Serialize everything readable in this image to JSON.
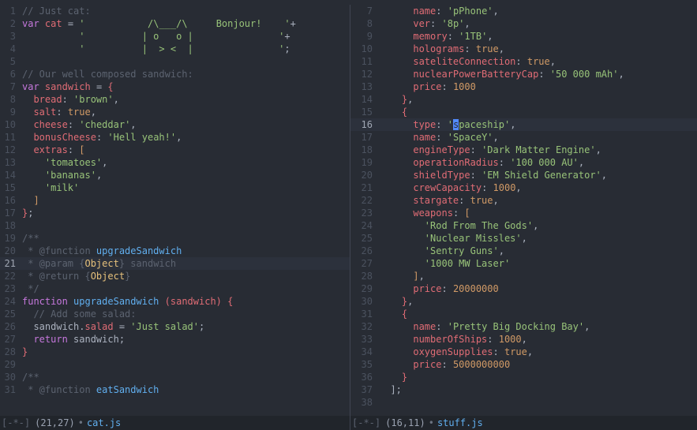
{
  "left": {
    "filename": "cat.js",
    "cursor": "(21,27)",
    "status_prefix": "[-*-]",
    "current_line": 21,
    "first_lineno": 1,
    "lines": [
      {
        "t": [
          [
            "cmt",
            "// Just cat:"
          ]
        ]
      },
      {
        "t": [
          [
            "kw",
            "var"
          ],
          [
            "p",
            " "
          ],
          [
            "prop",
            "cat"
          ],
          [
            "p",
            " = "
          ],
          [
            "str",
            "'           /\\___/\\     Bonjour!    '"
          ],
          [
            "p",
            "+"
          ]
        ]
      },
      {
        "t": [
          [
            "p",
            "          "
          ],
          [
            "str",
            "'          | o   o |               '"
          ],
          [
            "p",
            "+"
          ]
        ]
      },
      {
        "t": [
          [
            "p",
            "          "
          ],
          [
            "str",
            "'          |  > <  |               '"
          ],
          [
            "p",
            ";"
          ]
        ]
      },
      {
        "t": []
      },
      {
        "t": [
          [
            "cmt",
            "// Our well composed sandwich:"
          ]
        ]
      },
      {
        "t": [
          [
            "kw",
            "var"
          ],
          [
            "p",
            " "
          ],
          [
            "prop",
            "sandwich"
          ],
          [
            "p",
            " = "
          ],
          [
            "wrap1",
            "{"
          ]
        ]
      },
      {
        "t": [
          [
            "p",
            "  "
          ],
          [
            "prop",
            "bread"
          ],
          [
            "p",
            ": "
          ],
          [
            "str",
            "'brown'"
          ],
          [
            "p",
            ","
          ]
        ]
      },
      {
        "t": [
          [
            "p",
            "  "
          ],
          [
            "prop",
            "salt"
          ],
          [
            "p",
            ": "
          ],
          [
            "bool",
            "true"
          ],
          [
            "p",
            ","
          ]
        ]
      },
      {
        "t": [
          [
            "p",
            "  "
          ],
          [
            "prop",
            "cheese"
          ],
          [
            "p",
            ": "
          ],
          [
            "str",
            "'cheddar'"
          ],
          [
            "p",
            ","
          ]
        ]
      },
      {
        "t": [
          [
            "p",
            "  "
          ],
          [
            "prop",
            "bonusCheese"
          ],
          [
            "p",
            ": "
          ],
          [
            "str",
            "'Hell yeah!'"
          ],
          [
            "p",
            ","
          ]
        ]
      },
      {
        "t": [
          [
            "p",
            "  "
          ],
          [
            "prop",
            "extras"
          ],
          [
            "p",
            ": "
          ],
          [
            "wrap2",
            "["
          ]
        ]
      },
      {
        "t": [
          [
            "p",
            "    "
          ],
          [
            "str",
            "'tomatoes'"
          ],
          [
            "p",
            ","
          ]
        ]
      },
      {
        "t": [
          [
            "p",
            "    "
          ],
          [
            "str",
            "'bananas'"
          ],
          [
            "p",
            ","
          ]
        ]
      },
      {
        "t": [
          [
            "p",
            "    "
          ],
          [
            "str",
            "'milk'"
          ]
        ]
      },
      {
        "t": [
          [
            "p",
            "  "
          ],
          [
            "wrap2",
            "]"
          ]
        ]
      },
      {
        "t": [
          [
            "wrap1",
            "}"
          ],
          [
            "p",
            ";"
          ]
        ]
      },
      {
        "t": []
      },
      {
        "t": [
          [
            "cmt",
            "/**"
          ]
        ]
      },
      {
        "t": [
          [
            "cmt",
            " * @function "
          ],
          [
            "fn",
            "upgradeSandwich"
          ]
        ]
      },
      {
        "t": [
          [
            "cmt",
            " * @param {"
          ],
          [
            "type",
            "Object"
          ],
          [
            "cmt",
            "} sandwich"
          ]
        ]
      },
      {
        "t": [
          [
            "cmt",
            " * @return {"
          ],
          [
            "type",
            "Object"
          ],
          [
            "cmt",
            "}"
          ]
        ]
      },
      {
        "t": [
          [
            "cmt",
            " */"
          ]
        ]
      },
      {
        "t": [
          [
            "kw",
            "function"
          ],
          [
            "p",
            " "
          ],
          [
            "fn",
            "upgradeSandwich"
          ],
          [
            "p",
            " "
          ],
          [
            "wrap1",
            "("
          ],
          [
            "prm",
            "sandwich"
          ],
          [
            "wrap1",
            ")"
          ],
          [
            "p",
            " "
          ],
          [
            "wrap1",
            "{"
          ]
        ]
      },
      {
        "t": [
          [
            "p",
            "  "
          ],
          [
            "cmt",
            "// Add some salad:"
          ]
        ]
      },
      {
        "t": [
          [
            "p",
            "  sandwich."
          ],
          [
            "prop",
            "salad"
          ],
          [
            "p",
            " = "
          ],
          [
            "str",
            "'Just salad'"
          ],
          [
            "p",
            ";"
          ]
        ]
      },
      {
        "t": [
          [
            "p",
            "  "
          ],
          [
            "kw",
            "return"
          ],
          [
            "p",
            " sandwich;"
          ]
        ]
      },
      {
        "t": [
          [
            "wrap1",
            "}"
          ]
        ]
      },
      {
        "t": []
      },
      {
        "t": [
          [
            "cmt",
            "/**"
          ]
        ]
      },
      {
        "t": [
          [
            "cmt",
            " * @function "
          ],
          [
            "fn",
            "eatSandwich"
          ]
        ]
      }
    ]
  },
  "right": {
    "filename": "stuff.js",
    "cursor": "(16,11)",
    "status_prefix": "[-*-]",
    "current_line": 16,
    "first_lineno": 7,
    "lines": [
      {
        "t": [
          [
            "p",
            "      "
          ],
          [
            "prop",
            "name"
          ],
          [
            "p",
            ": "
          ],
          [
            "str",
            "'pPhone'"
          ],
          [
            "p",
            ","
          ]
        ]
      },
      {
        "t": [
          [
            "p",
            "      "
          ],
          [
            "prop",
            "ver"
          ],
          [
            "p",
            ": "
          ],
          [
            "str",
            "'8p'"
          ],
          [
            "p",
            ","
          ]
        ]
      },
      {
        "t": [
          [
            "p",
            "      "
          ],
          [
            "prop",
            "memory"
          ],
          [
            "p",
            ": "
          ],
          [
            "str",
            "'1TB'"
          ],
          [
            "p",
            ","
          ]
        ]
      },
      {
        "t": [
          [
            "p",
            "      "
          ],
          [
            "prop",
            "holograms"
          ],
          [
            "p",
            ": "
          ],
          [
            "bool",
            "true"
          ],
          [
            "p",
            ","
          ]
        ]
      },
      {
        "t": [
          [
            "p",
            "      "
          ],
          [
            "prop",
            "sateliteConnection"
          ],
          [
            "p",
            ": "
          ],
          [
            "bool",
            "true"
          ],
          [
            "p",
            ","
          ]
        ]
      },
      {
        "t": [
          [
            "p",
            "      "
          ],
          [
            "prop",
            "nuclearPowerBatteryCap"
          ],
          [
            "p",
            ": "
          ],
          [
            "str",
            "'50 000 mAh'"
          ],
          [
            "p",
            ","
          ]
        ]
      },
      {
        "t": [
          [
            "p",
            "      "
          ],
          [
            "prop",
            "price"
          ],
          [
            "p",
            ": "
          ],
          [
            "num",
            "1000"
          ]
        ]
      },
      {
        "t": [
          [
            "p",
            "    "
          ],
          [
            "wrap1",
            "}"
          ],
          [
            "p",
            ","
          ]
        ]
      },
      {
        "t": [
          [
            "p",
            "    "
          ],
          [
            "wrap1",
            "{"
          ]
        ]
      },
      {
        "t": [
          [
            "p",
            "      "
          ],
          [
            "prop",
            "type"
          ],
          [
            "p",
            ": "
          ],
          [
            "str",
            "'"
          ],
          [
            "cur",
            "s"
          ],
          [
            "str",
            "paceship'"
          ],
          [
            "p",
            ","
          ]
        ]
      },
      {
        "t": [
          [
            "p",
            "      "
          ],
          [
            "prop",
            "name"
          ],
          [
            "p",
            ": "
          ],
          [
            "str",
            "'SpaceY'"
          ],
          [
            "p",
            ","
          ]
        ]
      },
      {
        "t": [
          [
            "p",
            "      "
          ],
          [
            "prop",
            "engineType"
          ],
          [
            "p",
            ": "
          ],
          [
            "str",
            "'Dark Matter Engine'"
          ],
          [
            "p",
            ","
          ]
        ]
      },
      {
        "t": [
          [
            "p",
            "      "
          ],
          [
            "prop",
            "operationRadius"
          ],
          [
            "p",
            ": "
          ],
          [
            "str",
            "'100 000 AU'"
          ],
          [
            "p",
            ","
          ]
        ]
      },
      {
        "t": [
          [
            "p",
            "      "
          ],
          [
            "prop",
            "shieldType"
          ],
          [
            "p",
            ": "
          ],
          [
            "str",
            "'EM Shield Generator'"
          ],
          [
            "p",
            ","
          ]
        ]
      },
      {
        "t": [
          [
            "p",
            "      "
          ],
          [
            "prop",
            "crewCapacity"
          ],
          [
            "p",
            ": "
          ],
          [
            "num",
            "1000"
          ],
          [
            "p",
            ","
          ]
        ]
      },
      {
        "t": [
          [
            "p",
            "      "
          ],
          [
            "prop",
            "stargate"
          ],
          [
            "p",
            ": "
          ],
          [
            "bool",
            "true"
          ],
          [
            "p",
            ","
          ]
        ]
      },
      {
        "t": [
          [
            "p",
            "      "
          ],
          [
            "prop",
            "weapons"
          ],
          [
            "p",
            ": "
          ],
          [
            "wrap2",
            "["
          ]
        ]
      },
      {
        "t": [
          [
            "p",
            "        "
          ],
          [
            "str",
            "'Rod From The Gods'"
          ],
          [
            "p",
            ","
          ]
        ]
      },
      {
        "t": [
          [
            "p",
            "        "
          ],
          [
            "str",
            "'Nuclear Missles'"
          ],
          [
            "p",
            ","
          ]
        ]
      },
      {
        "t": [
          [
            "p",
            "        "
          ],
          [
            "str",
            "'Sentry Guns'"
          ],
          [
            "p",
            ","
          ]
        ]
      },
      {
        "t": [
          [
            "p",
            "        "
          ],
          [
            "str",
            "'1000 MW Laser'"
          ]
        ]
      },
      {
        "t": [
          [
            "p",
            "      "
          ],
          [
            "wrap2",
            "]"
          ],
          [
            "p",
            ","
          ]
        ]
      },
      {
        "t": [
          [
            "p",
            "      "
          ],
          [
            "prop",
            "price"
          ],
          [
            "p",
            ": "
          ],
          [
            "num",
            "20000000"
          ]
        ]
      },
      {
        "t": [
          [
            "p",
            "    "
          ],
          [
            "wrap1",
            "}"
          ],
          [
            "p",
            ","
          ]
        ]
      },
      {
        "t": [
          [
            "p",
            "    "
          ],
          [
            "wrap1",
            "{"
          ]
        ]
      },
      {
        "t": [
          [
            "p",
            "      "
          ],
          [
            "prop",
            "name"
          ],
          [
            "p",
            ": "
          ],
          [
            "str",
            "'Pretty Big Docking Bay'"
          ],
          [
            "p",
            ","
          ]
        ]
      },
      {
        "t": [
          [
            "p",
            "      "
          ],
          [
            "prop",
            "numberOfShips"
          ],
          [
            "p",
            ": "
          ],
          [
            "num",
            "1000"
          ],
          [
            "p",
            ","
          ]
        ]
      },
      {
        "t": [
          [
            "p",
            "      "
          ],
          [
            "prop",
            "oxygenSupplies"
          ],
          [
            "p",
            ": "
          ],
          [
            "bool",
            "true"
          ],
          [
            "p",
            ","
          ]
        ]
      },
      {
        "t": [
          [
            "p",
            "      "
          ],
          [
            "prop",
            "price"
          ],
          [
            "p",
            ": "
          ],
          [
            "num",
            "5000000000"
          ]
        ]
      },
      {
        "t": [
          [
            "p",
            "    "
          ],
          [
            "wrap1",
            "}"
          ]
        ]
      },
      {
        "t": [
          [
            "p",
            "  "
          ],
          [
            "p",
            "];"
          ]
        ]
      },
      {
        "t": []
      }
    ]
  }
}
